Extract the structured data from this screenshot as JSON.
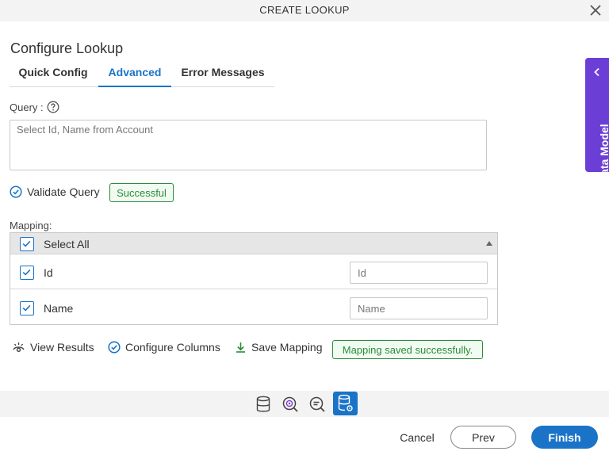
{
  "dialog": {
    "title": "CREATE LOOKUP"
  },
  "heading": "Configure Lookup",
  "tabs": [
    {
      "label": "Quick Config"
    },
    {
      "label": "Advanced"
    },
    {
      "label": "Error Messages"
    }
  ],
  "query": {
    "label": "Query :",
    "value": "Select Id, Name from Account"
  },
  "validate": {
    "label": "Validate Query",
    "status": "Successful"
  },
  "mapping": {
    "label": "Mapping:",
    "select_all": "Select All",
    "rows": [
      {
        "label": "Id",
        "value": "Id"
      },
      {
        "label": "Name",
        "value": "Name"
      }
    ]
  },
  "actions": {
    "view_results": "View Results",
    "configure_columns": "Configure Columns",
    "save_mapping": "Save Mapping",
    "save_status": "Mapping saved successfully."
  },
  "side_panel": {
    "label": "Data Model"
  },
  "footer": {
    "cancel": "Cancel",
    "prev": "Prev",
    "finish": "Finish"
  },
  "colors": {
    "accent": "#1a73c7",
    "success": "#2e8b3a",
    "side_panel": "#6b3fd6"
  }
}
